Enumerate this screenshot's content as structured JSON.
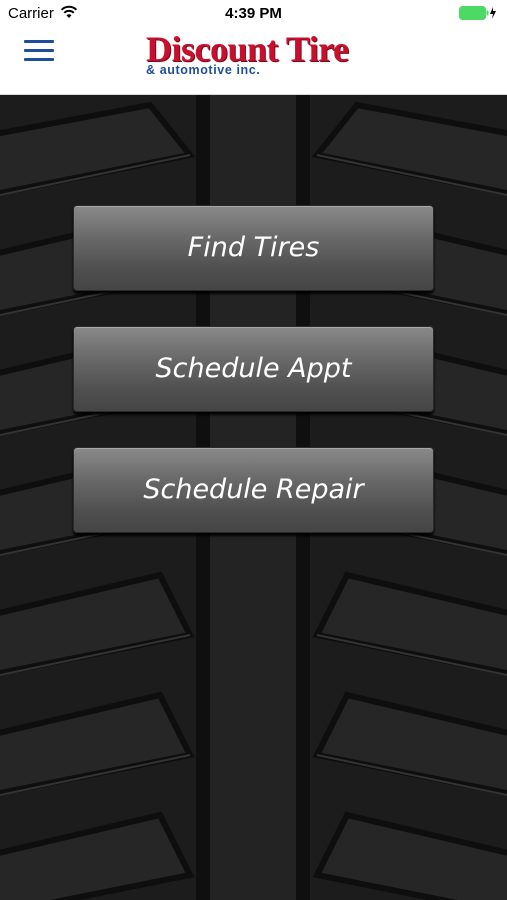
{
  "status_bar": {
    "carrier": "Carrier",
    "time": "4:39 PM",
    "battery_color": "#4cd964"
  },
  "header": {
    "logo_main": "Discount Tire",
    "logo_sub": "& automotive inc.",
    "brand_red": "#c8102e",
    "brand_blue": "#1f4e99",
    "menu_icon": "hamburger-menu-icon"
  },
  "actions": {
    "find_tires": "Find Tires",
    "schedule_appt": "Schedule Appt",
    "schedule_repair": "Schedule Repair"
  },
  "background": "tire-tread-texture"
}
